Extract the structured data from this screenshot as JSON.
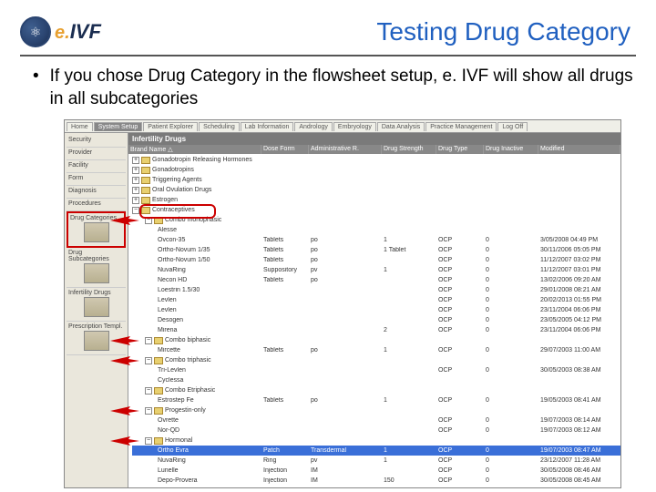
{
  "title": "Testing Drug Category",
  "logo": {
    "e": "e.",
    "ivf": "IVF",
    "atom": "⚛"
  },
  "bullet": "If you chose Drug Category in the flowsheet setup, e. IVF will show all drugs in all subcategories",
  "tabs": [
    "Home",
    "System Setup",
    "Patient Explorer",
    "Scheduling",
    "Lab Information",
    "Andrology",
    "Embryology",
    "Data Analysis",
    "Practice Management",
    "Log Off"
  ],
  "active_tab": 1,
  "sidebar": [
    "Security",
    "Provider",
    "Facility",
    "Form",
    "Diagnosis",
    "Procedures",
    "Drug Categories",
    "Drug Subcategories",
    "Infertility Drugs",
    "Prescription Templ."
  ],
  "panel_title": "Infertility Drugs",
  "columns": [
    "Brand Name  △",
    "Dose Form",
    "Administrative R.",
    "Drug Strength",
    "Drug Type",
    "Drug Inactive",
    "Modified"
  ],
  "top_nodes": [
    "Gonadotropin Releasing Hormones",
    "Gonadotropins",
    "Triggering Agents",
    "Oral Ovulation Drugs",
    "Estrogen",
    "Contraceptives"
  ],
  "mono_node": "Combo monophasic",
  "mono_rows": [
    {
      "n": "Alesse",
      "d": "",
      "a": "",
      "s": "",
      "t": "",
      "i": "",
      "m": ""
    },
    {
      "n": "Ovcon-35",
      "d": "Tablets",
      "a": "po",
      "s": "1",
      "t": "OCP",
      "i": "0",
      "m": "3/05/2008 04:49 PM"
    },
    {
      "n": "Ortho-Novum 1/35",
      "d": "Tablets",
      "a": "po",
      "s": "1 Tablet",
      "t": "OCP",
      "i": "0",
      "m": "30/11/2006 05:05 PM"
    },
    {
      "n": "Ortho-Novum 1/50",
      "d": "Tablets",
      "a": "po",
      "s": "",
      "t": "OCP",
      "i": "0",
      "m": "11/12/2007 03:02 PM"
    },
    {
      "n": "NuvaRing",
      "d": "Suppository",
      "a": "pv",
      "s": "1",
      "t": "OCP",
      "i": "0",
      "m": "11/12/2007 03:01 PM"
    },
    {
      "n": "Necon HD",
      "d": "Tablets",
      "a": "po",
      "s": "",
      "t": "OCP",
      "i": "0",
      "m": "13/02/2006 09:20 AM"
    },
    {
      "n": "Loestrin 1.5/30",
      "d": "",
      "a": "",
      "s": "",
      "t": "OCP",
      "i": "0",
      "m": "29/01/2008 08:21 AM"
    },
    {
      "n": "Levlen",
      "d": "",
      "a": "",
      "s": "",
      "t": "OCP",
      "i": "0",
      "m": "20/02/2013 01:55 PM"
    },
    {
      "n": "Levlen",
      "d": "",
      "a": "",
      "s": "",
      "t": "OCP",
      "i": "0",
      "m": "23/11/2004 06:06 PM"
    },
    {
      "n": "Desogen",
      "d": "",
      "a": "",
      "s": "",
      "t": "OCP",
      "i": "0",
      "m": "23/05/2005 04:12 PM"
    },
    {
      "n": "Mirena",
      "d": "",
      "a": "",
      "s": "2",
      "t": "OCP",
      "i": "0",
      "m": "23/11/2004 06:06 PM"
    }
  ],
  "biphasic_node": "Combo biphasic",
  "biphasic_rows": [
    {
      "n": "Mircette",
      "d": "Tablets",
      "a": "po",
      "s": "1",
      "t": "OCP",
      "i": "0",
      "m": "29/07/2003 11:00 AM"
    }
  ],
  "triphasic_node": "Combo triphasic",
  "triphasic_rows": [
    {
      "n": "Tri-Levlen",
      "d": "",
      "a": "",
      "s": "",
      "t": "OCP",
      "i": "0",
      "m": "30/05/2003 08:38 AM"
    },
    {
      "n": "Cyclessa",
      "d": "",
      "a": "",
      "s": "",
      "t": "",
      "i": "",
      "m": ""
    }
  ],
  "etriphasic_node": "Combo Etriphasic",
  "etriphasic_rows": [
    {
      "n": "Estrostep Fe",
      "d": "Tablets",
      "a": "po",
      "s": "1",
      "t": "OCP",
      "i": "0",
      "m": "19/05/2003 08:41 AM"
    }
  ],
  "prog_node": "Progestin-only",
  "prog_rows": [
    {
      "n": "Ovrette",
      "d": "",
      "a": "",
      "s": "",
      "t": "OCP",
      "i": "0",
      "m": "19/07/2003 08:14 AM"
    },
    {
      "n": "Nor-QD",
      "d": "",
      "a": "",
      "s": "",
      "t": "OCP",
      "i": "0",
      "m": "19/07/2003 08:12 AM"
    }
  ],
  "hormonal_node": "Hormonal",
  "hormonal_rows": [
    {
      "n": "Ortho Evra",
      "d": "Patch",
      "a": "Transdermal",
      "s": "1",
      "t": "OCP",
      "i": "0",
      "m": "19/07/2003 08:47 AM"
    },
    {
      "n": "NuvaRing",
      "d": "Ring",
      "a": "pv",
      "s": "1",
      "t": "OCP",
      "i": "0",
      "m": "23/12/2007 11:28 AM"
    },
    {
      "n": "Lunelle",
      "d": "Injection",
      "a": "IM",
      "s": "",
      "t": "OCP",
      "i": "0",
      "m": "30/05/2008 08:46 AM"
    },
    {
      "n": "Depo-Provera",
      "d": "Injection",
      "a": "IM",
      "s": "150",
      "t": "OCP",
      "i": "0",
      "m": "30/05/2008 08:45 AM"
    }
  ]
}
